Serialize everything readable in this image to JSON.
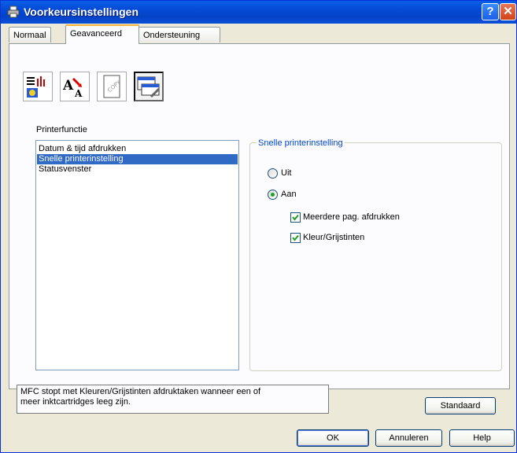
{
  "window": {
    "title": "Voorkeursinstellingen",
    "help_label": "?",
    "close_label": "✕"
  },
  "tabs": [
    {
      "label": "Normaal",
      "active": false
    },
    {
      "label": "Geavanceerd",
      "active": true
    },
    {
      "label": "Ondersteuning",
      "active": false
    }
  ],
  "icon_buttons": [
    {
      "icon": "color-settings-icon",
      "selected": false
    },
    {
      "icon": "font-scaling-icon",
      "selected": false
    },
    {
      "icon": "watermark-copy-icon",
      "selected": false
    },
    {
      "icon": "printer-function-icon",
      "selected": true
    }
  ],
  "printer_function": {
    "label": "Printerfunctie",
    "items": [
      "Datum & tijd afdrukken",
      "Snelle printerinstelling",
      "Statusvenster"
    ],
    "selected_index": 1
  },
  "quick_setup": {
    "legend": "Snelle printerinstelling",
    "off_label": "Uit",
    "on_label": "Aan",
    "selected": "Aan",
    "multi_page_label": "Meerdere pag. afdrukken",
    "multi_page_checked": true,
    "color_gray_label": "Kleur/Grijstinten",
    "color_gray_checked": true
  },
  "status": {
    "line1": "MFC stopt met Kleuren/Grijstinten afdruktaken wanneer een of",
    "line2": "meer inktcartridges leeg zijn."
  },
  "buttons": {
    "default_label": "Standaard",
    "ok_label": "OK",
    "cancel_label": "Annuleren",
    "help_label": "Help"
  },
  "colors": {
    "titlebar": "#0549d6",
    "selection": "#316ac5",
    "legend_text": "#0046d5",
    "check": "#21a121"
  }
}
